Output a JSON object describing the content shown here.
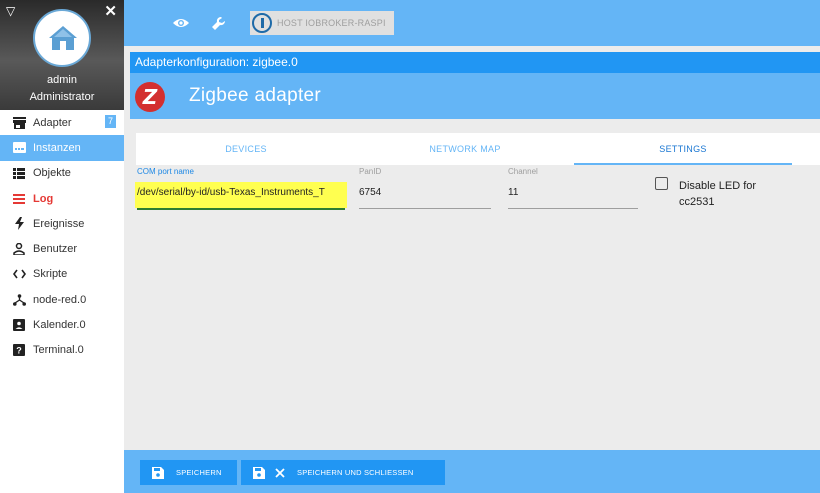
{
  "sidebar": {
    "user": {
      "name": "admin",
      "role": "Administrator"
    },
    "items": [
      {
        "label": "Adapter",
        "icon": "store-icon",
        "badge": "7"
      },
      {
        "label": "Instanzen",
        "icon": "instances-icon"
      },
      {
        "label": "Objekte",
        "icon": "list-icon"
      },
      {
        "label": "Log",
        "icon": "log-lines-icon"
      },
      {
        "label": "Ereignisse",
        "icon": "lightning-icon"
      },
      {
        "label": "Benutzer",
        "icon": "person-icon"
      },
      {
        "label": "Skripte",
        "icon": "code-icon"
      },
      {
        "label": "node-red.0",
        "icon": "node-red-icon"
      },
      {
        "label": "Kalender.0",
        "icon": "calendar-badge-icon"
      },
      {
        "label": "Terminal.0",
        "icon": "help-box-icon"
      }
    ]
  },
  "topbar": {
    "host_label": "HOST IOBROKER-RASPI"
  },
  "panel": {
    "title": "Adapterkonfiguration: zigbee.0",
    "adapter_title": "Zigbee adapter",
    "tabs": [
      {
        "label": "DEVICES"
      },
      {
        "label": "NETWORK MAP"
      },
      {
        "label": "SETTINGS"
      }
    ],
    "selected_tab": "SETTINGS",
    "fields": {
      "com_port": {
        "label": "COM port name",
        "value": "/dev/serial/by-id/usb-Texas_Instruments_T"
      },
      "panid": {
        "label": "PanID",
        "value": "6754"
      },
      "channel": {
        "label": "Channel",
        "value": "11"
      },
      "disable_led": {
        "label": "Disable LED for cc2531",
        "checked": false
      }
    }
  },
  "bottombar": {
    "save_label": "SPEICHERN",
    "save_close_label": "SPEICHERN UND SCHLIESSEN"
  },
  "colors": {
    "accent": "#64b5f6",
    "accent_dark": "#2196f3",
    "log_red": "#e53935",
    "highlight": "#ffff50"
  }
}
